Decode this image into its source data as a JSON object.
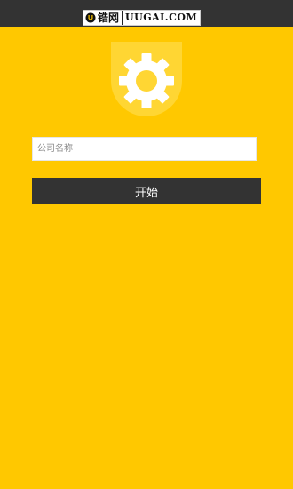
{
  "watermark": {
    "brand_cn": "锆网",
    "brand_en": "UUGAI.COM"
  },
  "form": {
    "company_placeholder": "公司名称",
    "company_value": "",
    "start_label": "开始"
  },
  "colors": {
    "background": "#ffc800",
    "status_bar": "#333333",
    "logo_shield": "#ffd633",
    "button": "#333333",
    "button_text": "#ffffff"
  },
  "icons": {
    "logo": "gear-shield-icon"
  }
}
